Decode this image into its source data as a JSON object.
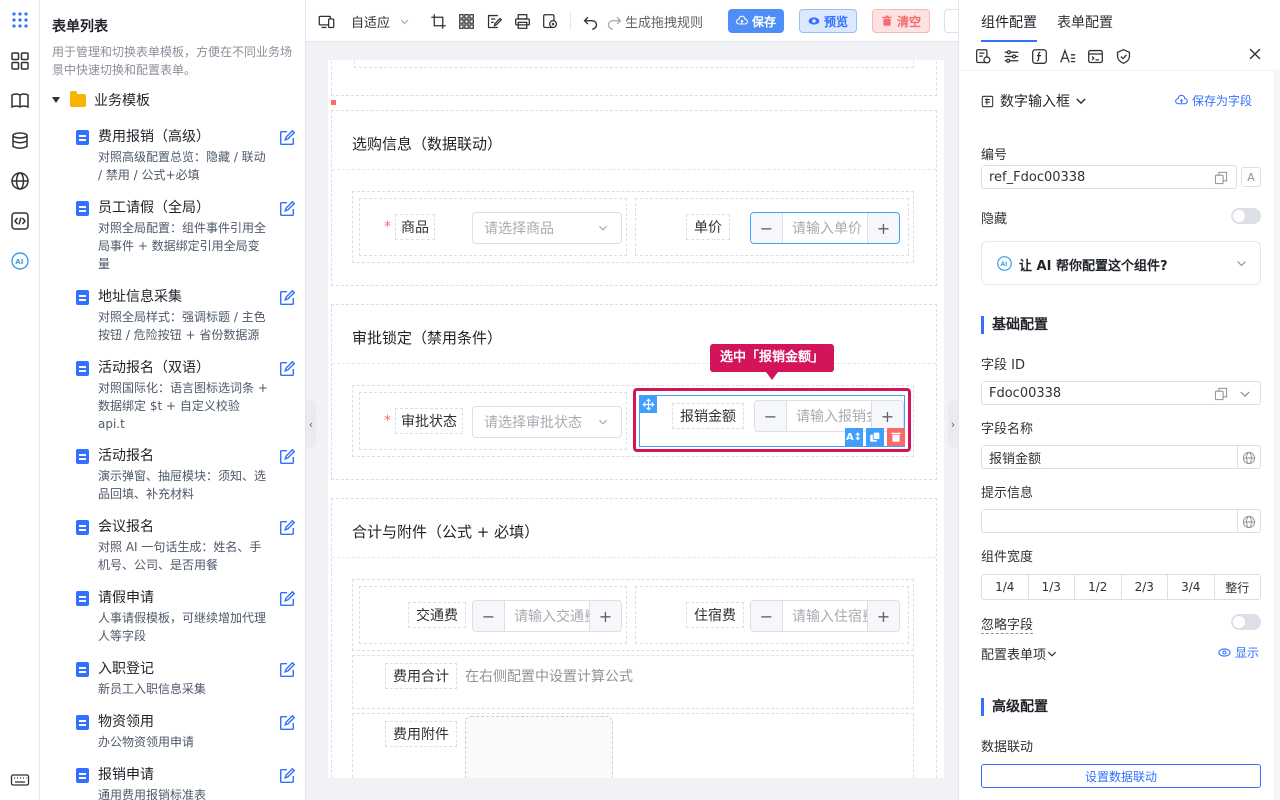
{
  "list": {
    "title": "表单列表",
    "description": "用于管理和切换表单模板，方便在不同业务场景中快速切换和配置表单。",
    "folder": "业务模板",
    "items": [
      {
        "name": "费用报销（高级）",
        "desc": "对照高级配置总览：隐藏 / 联动 / 禁用 / 公式+必填"
      },
      {
        "name": "员工请假（全局）",
        "desc": "对照全局配置：组件事件引用全局事件 + 数据绑定引用全局变量"
      },
      {
        "name": "地址信息采集",
        "desc": "对照全局样式：强调标题 / 主色按钮 / 危险按钮 + 省份数据源"
      },
      {
        "name": "活动报名（双语）",
        "desc": "对照国际化：语言图标选词条 + 数据绑定 $t + 自定义校验 api.t"
      },
      {
        "name": "活动报名",
        "desc": "演示弹窗、抽屉模块：须知、选品回填、补充材料"
      },
      {
        "name": "会议报名",
        "desc": "对照 AI 一句话生成：姓名、手机号、公司、是否用餐"
      },
      {
        "name": "请假申请",
        "desc": "人事请假模板，可继续增加代理人等字段"
      },
      {
        "name": "入职登记",
        "desc": "新员工入职信息采集"
      },
      {
        "name": "物资领用",
        "desc": "办公物资领用申请"
      },
      {
        "name": "报销申请",
        "desc": "通用费用报销标准表"
      }
    ]
  },
  "toolbar": {
    "adaptive": "自适应",
    "gen_rules": "生成拖拽规则",
    "save": "保存",
    "preview": "预览",
    "clear": "清空"
  },
  "canvas": {
    "sections": [
      {
        "title": "选购信息（数据联动）"
      },
      {
        "title": "审批锁定（禁用条件）"
      },
      {
        "title": "合计与附件（公式 + 必填）"
      }
    ],
    "fields": {
      "product_label": "商品",
      "product_ph": "请选择商品",
      "price_label": "单价",
      "price_ph": "请输入单价",
      "approval_label": "审批状态",
      "approval_ph": "请选择审批状态",
      "amount_label": "报销金额",
      "amount_ph": "请输入报销金额",
      "traffic_label": "交通费",
      "traffic_ph": "请输入交通费",
      "hotel_label": "住宿费",
      "hotel_ph": "请输入住宿费",
      "total_label": "费用合计",
      "total_hint": "在右侧配置中设置计算公式",
      "attach_label": "费用附件"
    },
    "callout": "选中「报销金额」",
    "minus": "−",
    "plus": "+"
  },
  "config": {
    "tabs": [
      "组件配置",
      "表单配置"
    ],
    "component_type": "数字输入框",
    "save_as_field": "保存为字段",
    "code_label": "编号",
    "code_value": "ref_Fdoc00338",
    "hidden_label": "隐藏",
    "ai_prompt": "让 AI 帮你配置这个组件?",
    "basic_title": "基础配置",
    "field_id_label": "字段 ID",
    "field_id_value": "Fdoc00338",
    "field_name_label": "字段名称",
    "field_name_value": "报销金额",
    "hint_label": "提示信息",
    "hint_value": "",
    "width_label": "组件宽度",
    "width_options": [
      "1/4",
      "1/3",
      "1/2",
      "2/3",
      "3/4",
      "整行"
    ],
    "ignore_label": "忽略字段",
    "form_items_label": "配置表单项",
    "show_label": "显示",
    "advanced_title": "高级配置",
    "linkage_label": "数据联动",
    "linkage_btn": "设置数据联动"
  },
  "colors": {
    "primary": "#3370ff",
    "save_bg": "#4f8ef7",
    "preview_bg": "#dbe8ff",
    "clear_bg": "#fde2e2",
    "danger": "#f56c6c",
    "highlight": "#d4145a"
  }
}
